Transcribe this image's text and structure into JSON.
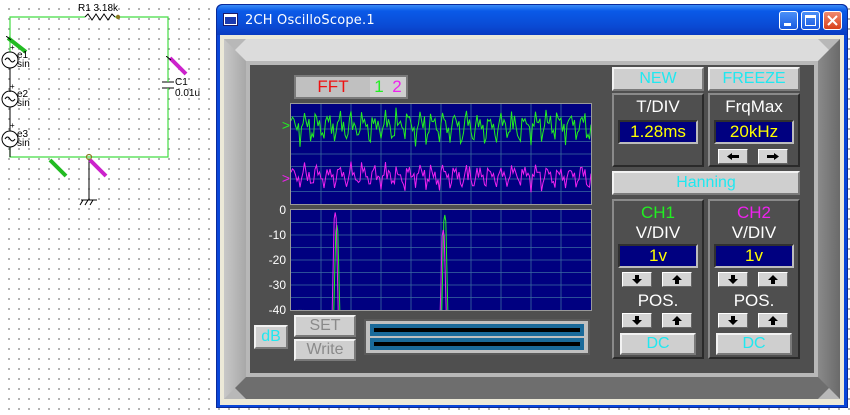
{
  "circuit": {
    "resistor_label": "R1 3.18k",
    "capacitor_name": "C1",
    "capacitor_value": "0.01u",
    "sources": [
      {
        "name": "e1",
        "type": "sin"
      },
      {
        "name": "e2",
        "type": "sin"
      },
      {
        "name": "e3",
        "type": "sin"
      }
    ],
    "colors": {
      "wire": "#44dd44",
      "probe_ch1": "#22bb22",
      "probe_ch2": "#cc22cc"
    }
  },
  "window": {
    "title": "2CH OscilloScope.1",
    "controls": {
      "minimize": "minimize-icon",
      "maximize": "maximize-icon",
      "close": "close-icon"
    }
  },
  "scope": {
    "mode_tab": {
      "label": "FFT",
      "ch1": "1",
      "ch2": "2"
    },
    "markers": {
      "ch1": ">",
      "ch2": ">"
    },
    "buttons": {
      "new": "NEW",
      "freeze": "FREEZE",
      "set": "SET",
      "write": "Write",
      "db": "dB"
    },
    "tdiv": {
      "label": "T/DIV",
      "value": "1.28ms"
    },
    "frqmax": {
      "label": "FrqMax",
      "value": "20kHz"
    },
    "window_func": "Hanning",
    "ch1": {
      "name": "CH1",
      "vdiv_label": "V/DIV",
      "vdiv": "1v",
      "pos_label": "POS.",
      "coupling": "DC"
    },
    "ch2": {
      "name": "CH2",
      "vdiv_label": "V/DIV",
      "vdiv": "1v",
      "pos_label": "POS.",
      "coupling": "DC"
    },
    "fft_axis": [
      "0",
      "-10",
      "-20",
      "-30",
      "-40"
    ],
    "colors": {
      "ch1": "#22ee22",
      "ch2": "#ee22ee",
      "screen_bg": "#000080",
      "grid": "#3a6aa0",
      "lcd_text": "#ffff00",
      "cyan_text": "#20e8f0"
    }
  },
  "chart_data": {
    "type": "line",
    "ylim": [
      -40,
      0
    ],
    "series": [
      {
        "name": "1",
        "peaks": [
          {
            "x": 0.03,
            "y": -40
          },
          {
            "x": 0.15,
            "y": -6
          },
          {
            "x": 0.51,
            "y": -2
          }
        ]
      },
      {
        "name": "2",
        "peaks": [
          {
            "x": 0.03,
            "y": -40
          },
          {
            "x": 0.15,
            "y": -1
          },
          {
            "x": 0.51,
            "y": -8
          }
        ]
      }
    ]
  }
}
